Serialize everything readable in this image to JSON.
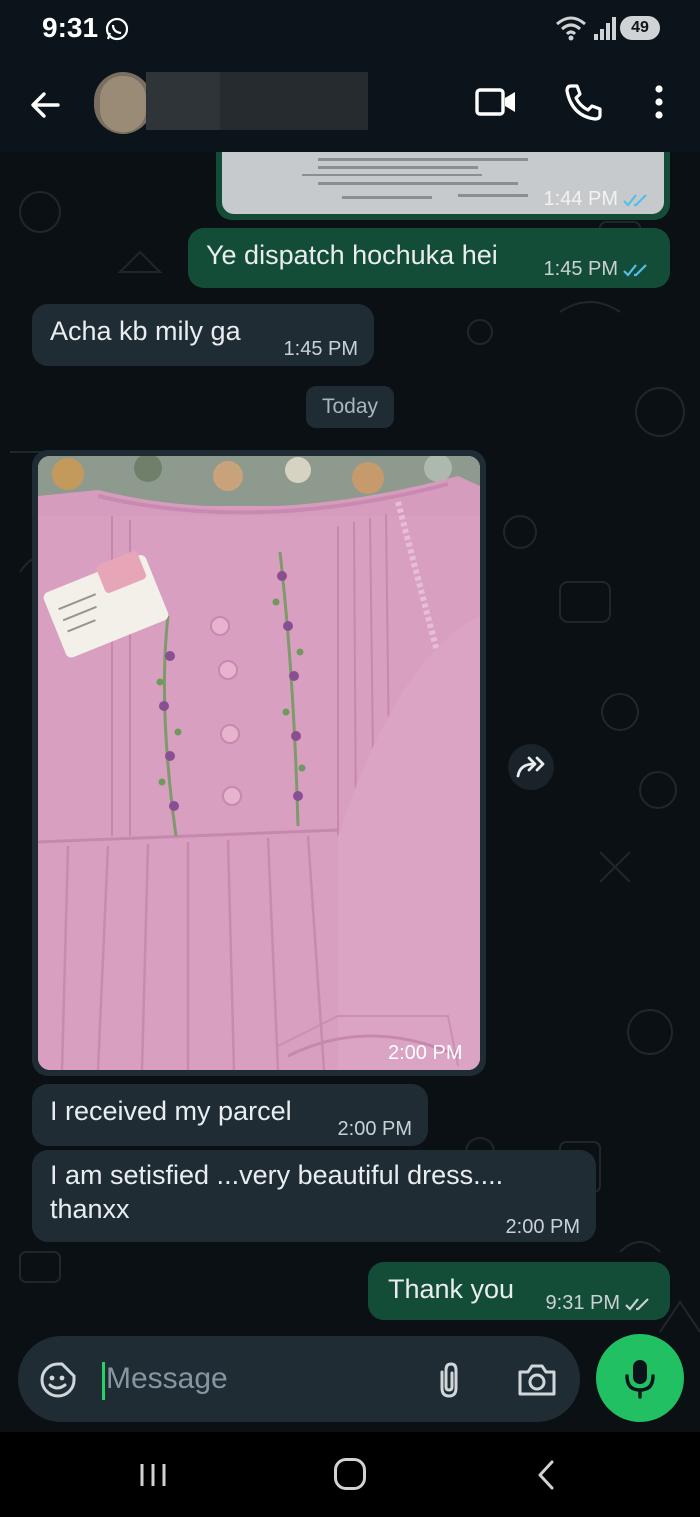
{
  "status_bar": {
    "time": "9:31",
    "battery": "49",
    "icons": [
      "whatsapp-icon",
      "wifi-icon",
      "signal-icon",
      "battery-icon"
    ]
  },
  "app_bar": {
    "icons": [
      "back-arrow-icon",
      "video-call-icon",
      "voice-call-icon",
      "more-options-icon"
    ]
  },
  "messages": [
    {
      "direction": "out",
      "kind": "image",
      "time": "1:44 PM",
      "status": "read"
    },
    {
      "direction": "out",
      "text": "Ye dispatch hochuka hei",
      "time": "1:45 PM",
      "status": "read"
    },
    {
      "direction": "in",
      "text": "Acha kb mily ga",
      "time": "1:45 PM"
    },
    {
      "kind": "date",
      "text": "Today"
    },
    {
      "direction": "in",
      "kind": "image",
      "time": "2:00 PM"
    },
    {
      "direction": "in",
      "text": "I received my parcel",
      "time": "2:00 PM"
    },
    {
      "direction": "in",
      "text": "I am setisfied ...very beautiful dress....",
      "text2": "thanxx",
      "time": "2:00 PM"
    },
    {
      "direction": "out",
      "text": "Thank you",
      "time": "9:31 PM",
      "status": "sent"
    }
  ],
  "composer": {
    "placeholder": "Message",
    "icons": [
      "emoji-sticker-icon",
      "attach-icon",
      "camera-icon",
      "mic-icon"
    ]
  },
  "colors": {
    "outgoing_bubble": "#144d37",
    "incoming_bubble": "#1f2c34",
    "accent": "#21c063",
    "read_ticks": "#53bdeb"
  }
}
